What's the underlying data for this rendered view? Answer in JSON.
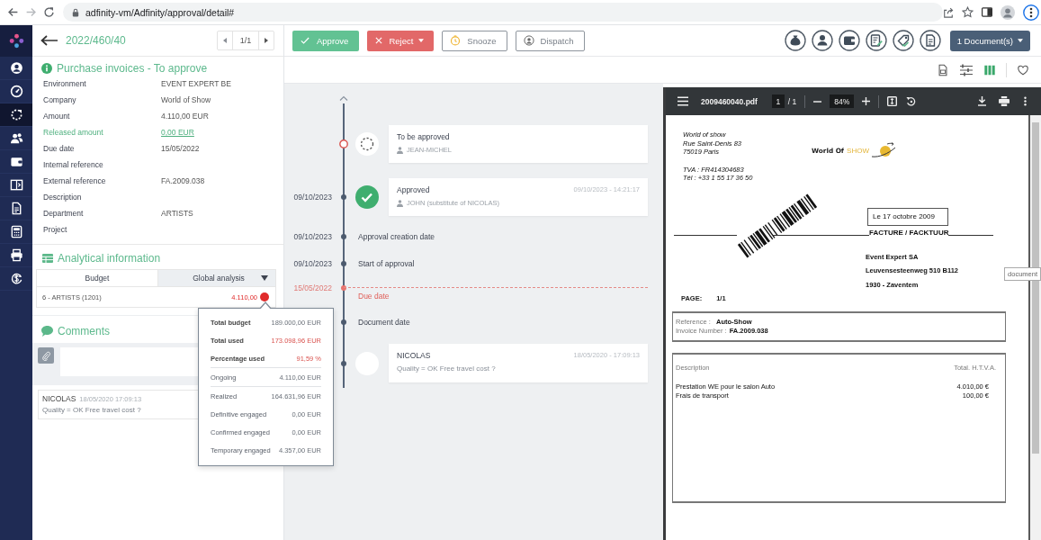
{
  "browser": {
    "url": "adfinity-vm/Adfinity/approval/detail#"
  },
  "sidebar": {
    "items": [
      {
        "selected": false
      },
      {
        "selected": false
      },
      {
        "selected": true
      },
      {
        "selected": false
      },
      {
        "selected": false
      },
      {
        "selected": false
      },
      {
        "selected": false
      },
      {
        "selected": false
      },
      {
        "selected": false
      },
      {
        "selected": false
      }
    ]
  },
  "record": {
    "number": "2022/460/40",
    "pager": "1/1"
  },
  "details": {
    "title": "Purchase invoices - To approve",
    "fields": [
      {
        "label": "Environment",
        "value": "EVENT EXPERT BE",
        "kind": "text"
      },
      {
        "label": "Company",
        "value": "World of Show",
        "kind": "text"
      },
      {
        "label": "Amount",
        "value": "4.110,00 EUR",
        "kind": "text"
      },
      {
        "label": "Released amount",
        "value": "0,00 EUR",
        "kind": "link"
      },
      {
        "label": "Due date",
        "value": "15/05/2022",
        "kind": "text"
      },
      {
        "label": "Internal reference",
        "kind": "text"
      },
      {
        "label": "External reference",
        "value": "FA.2009.038",
        "kind": "text"
      },
      {
        "label": "Description",
        "kind": "text"
      },
      {
        "label": "Department",
        "value": "ARTISTS",
        "kind": "text"
      },
      {
        "label": "Project",
        "kind": "text"
      }
    ]
  },
  "analytical": {
    "title": "Analytical information",
    "columns": [
      "Budget",
      "Global analysis"
    ],
    "rows": [
      {
        "name": "6 - ARTISTS (1201)",
        "amount": "4.110,00",
        "color": "#e02b2b"
      }
    ]
  },
  "budget_popup": {
    "groups": [
      [
        {
          "label": "Total budget",
          "value": "189.000,00 EUR",
          "kind": "total"
        },
        {
          "label": "Total used",
          "value": "173.098,96 EUR",
          "kind": "alert"
        },
        {
          "label": "Percentage used",
          "value": "91,59 %",
          "kind": "alert"
        }
      ],
      [
        {
          "label": "Ongoing",
          "value": "4.110,00 EUR",
          "kind": "detail"
        }
      ],
      [
        {
          "label": "Realized",
          "value": "164.631,96 EUR",
          "kind": "detail"
        },
        {
          "label": "Definitive engaged",
          "value": "0,00 EUR",
          "kind": "detail"
        },
        {
          "label": "Confirmed engaged",
          "value": "0,00 EUR",
          "kind": "detail"
        },
        {
          "label": "Temporary engaged",
          "value": "4.357,00 EUR",
          "kind": "detail"
        }
      ]
    ]
  },
  "comments": {
    "title": "Comments",
    "items": [
      {
        "author": "NICOLAS",
        "time": "18/05/2020 17:09:13",
        "text": "Quality = OK Free travel cost ?"
      }
    ]
  },
  "actions": [
    {
      "label": "Approve",
      "kind": "approve"
    },
    {
      "label": "Reject",
      "kind": "reject"
    },
    {
      "label": "Snooze",
      "kind": "snooze"
    },
    {
      "label": "Dispatch",
      "kind": "dispatch"
    }
  ],
  "documents_button": "1 Document(s)",
  "timeline": {
    "entries": [
      {
        "kind": "pending",
        "title": "To be approved",
        "user": "JEAN-MICHEL"
      },
      {
        "kind": "approved",
        "date": "09/10/2023",
        "title": "Approved",
        "time": "09/10/2023 - 14:21:17",
        "user": "JOHN (substitute of NICOLAS)"
      },
      {
        "kind": "milestone",
        "date": "09/10/2023",
        "title": "Approval creation date"
      },
      {
        "kind": "milestone",
        "date": "09/10/2023",
        "title": "Start of approval"
      },
      {
        "kind": "deadline",
        "date": "15/05/2022",
        "title": "Due date"
      },
      {
        "kind": "milestone",
        "title": "Document date"
      },
      {
        "kind": "comment",
        "title": "NICOLAS",
        "time": "18/05/2020 - 17:09:13",
        "text": "Quality = OK Free travel cost ?"
      }
    ]
  },
  "pdf_viewer": {
    "file": "2009460040.pdf",
    "page": "1",
    "page_total": "/ 1",
    "zoom": "84%",
    "tooltip": "document",
    "document": {
      "sender_address": [
        "World of show",
        "Rue Saint-Denis 83",
        "75019 Paris"
      ],
      "sender_contact": [
        "TVA : FR414304683",
        "Tél : +33 1 55 17 36 50"
      ],
      "logo": [
        "World Of",
        "SHOW"
      ],
      "date": "Le 17 octobre 2009",
      "heading": "FACTURE / FACKTUUR",
      "recipient": [
        "Event Expert SA",
        "Leuvensesteenweg 510 B112",
        "1930 - Zaventem"
      ],
      "page": {
        "label": "PAGE:",
        "value": "1/1"
      },
      "references": [
        {
          "label": "Reference :",
          "value": "Auto-Show"
        },
        {
          "label": "Invoice Number :",
          "value": "FA.2009.038"
        }
      ],
      "lines_header": [
        "Description",
        "Total. H.T.V.A."
      ],
      "lines": [
        {
          "description": "Prestation WE pour le salon Auto",
          "amount": "4.010,00 €"
        },
        {
          "description": "Frais de transport",
          "amount": "100,00 €"
        }
      ]
    }
  }
}
